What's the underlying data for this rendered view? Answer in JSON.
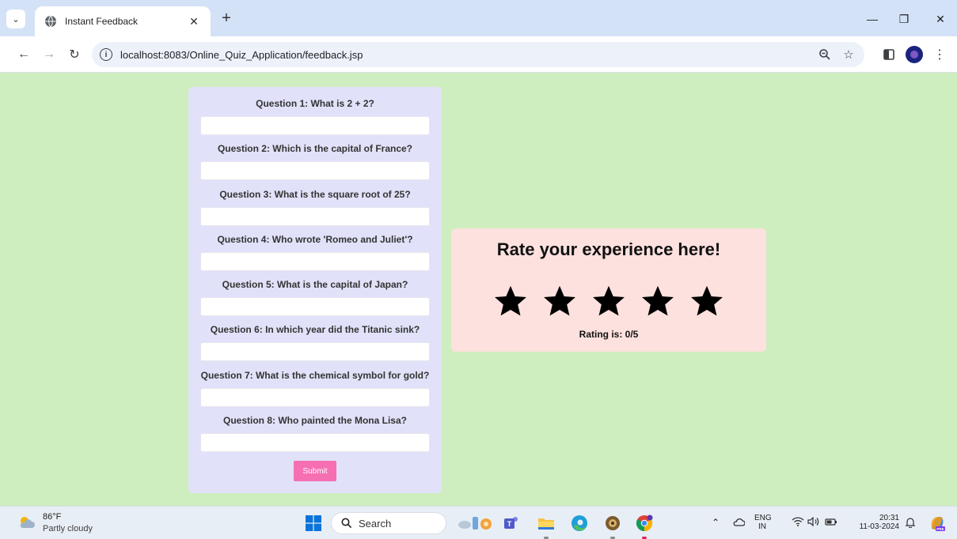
{
  "browser": {
    "tab_title": "Instant Feedback",
    "url": "localhost:8083/Online_Quiz_Application/feedback.jsp"
  },
  "quiz": {
    "questions": [
      {
        "label": "Question 1: What is 2 + 2?",
        "value": ""
      },
      {
        "label": "Question 2: Which is the capital of France?",
        "value": ""
      },
      {
        "label": "Question 3: What is the square root of 25?",
        "value": ""
      },
      {
        "label": "Question 4: Who wrote 'Romeo and Juliet'?",
        "value": ""
      },
      {
        "label": "Question 5: What is the capital of Japan?",
        "value": ""
      },
      {
        "label": "Question 6: In which year did the Titanic sink?",
        "value": ""
      },
      {
        "label": "Question 7: What is the chemical symbol for gold?",
        "value": ""
      },
      {
        "label": "Question 8: Who painted the Mona Lisa?",
        "value": ""
      }
    ],
    "submit_label": "Submit"
  },
  "rating": {
    "title": "Rate your experience here!",
    "text": "Rating is: 0/5",
    "value": 0,
    "max": 5
  },
  "taskbar": {
    "weather_temp": "86°F",
    "weather_desc": "Partly cloudy",
    "search_label": "Search",
    "lang_top": "ENG",
    "lang_bottom": "IN",
    "time": "20:31",
    "date": "11-03-2024"
  },
  "colors": {
    "page_bg": "#cfeec0",
    "quiz_panel_bg": "#e1e2f9",
    "rating_panel_bg": "#fde1de",
    "submit_bg": "#f66fb3",
    "star_color": "#000000"
  },
  "icons": {
    "tab_favicon": "globe-icon",
    "security": "info-icon",
    "zoom": "zoom-icon",
    "bookmark": "star-outline-icon",
    "sidepanel": "side-panel-icon",
    "menu": "kebab-menu-icon"
  }
}
